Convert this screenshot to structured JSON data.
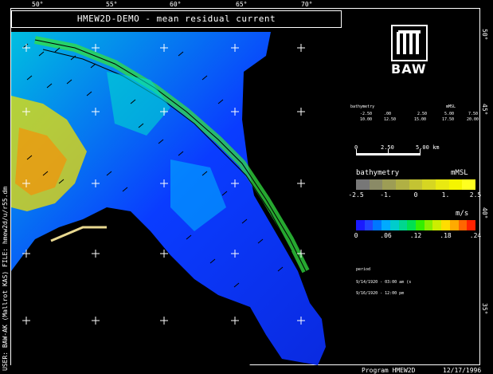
{
  "title": "HMEW2D-DEMO - mean residual current",
  "lon_ticks": [
    "50°",
    "55°",
    "60°",
    "65°",
    "70°"
  ],
  "lat_ticks": [
    "50°",
    "45°",
    "40°",
    "35°"
  ],
  "side_label": "USER: BAW-AK (Mallrot KAS) FILE: hmew2d/u/r55.dm",
  "logo_text": "BAW",
  "bathy_table": {
    "headers": [
      "bathymetry",
      "mMSL"
    ],
    "row1": [
      "-2.50",
      ".00",
      "2.50",
      "5.00",
      "7.50"
    ],
    "row2": [
      "10.00",
      "12.50",
      "15.00",
      "17.50",
      "20.00"
    ]
  },
  "scale": {
    "labels": [
      "0",
      "2.50",
      "5.00 km"
    ]
  },
  "bathy_legend": {
    "title": "bathymetry",
    "unit": "mMSL",
    "ticks": [
      "-2.5",
      "-1.",
      "0",
      "1.",
      "2.5"
    ],
    "colors": [
      "#777777",
      "#8a8a66",
      "#9d9d55",
      "#b0b044",
      "#c3c333",
      "#d6d622",
      "#e9e911",
      "#f5f500",
      "#ffff20"
    ]
  },
  "speed_legend": {
    "unit": "m/s",
    "ticks": [
      "0",
      ".06",
      ".12",
      ".18",
      ".24"
    ],
    "colors": [
      "#1a1aff",
      "#2244ff",
      "#0077ff",
      "#00aaff",
      "#00cccc",
      "#00d68f",
      "#00e050",
      "#33ee00",
      "#88ee00",
      "#ccee00",
      "#ffdd00",
      "#ffaa00",
      "#ff6600",
      "#ff2200"
    ]
  },
  "period": {
    "label": "period",
    "from": "9/14/1920 - 03:00 am (s",
    "to": "9/16/1920 - 12:00 pm"
  },
  "footer": {
    "program": "Program HMEW2D",
    "date": "12/17/1996"
  },
  "colors": {
    "land": "#000000",
    "frame": "#ffffff"
  }
}
